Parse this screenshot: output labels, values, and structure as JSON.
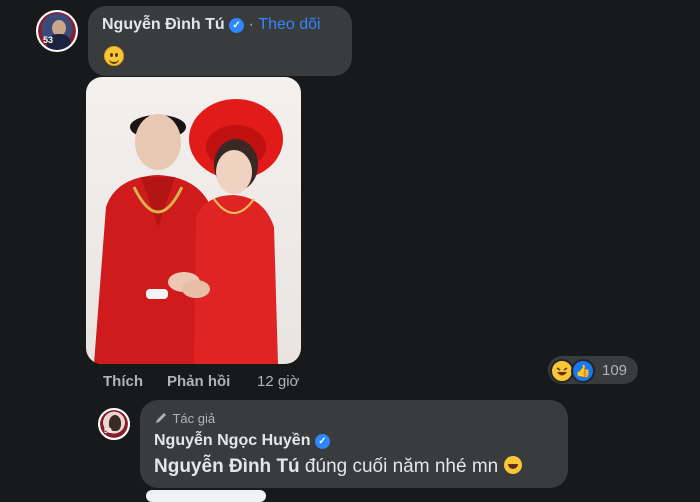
{
  "comment1": {
    "author": "Nguyễn Đình Tú",
    "follow_label": "Theo dõi",
    "separator": "·",
    "avatar_number": "53",
    "actions": {
      "like": "Thích",
      "reply": "Phản hồi",
      "time": "12 giờ"
    },
    "reactions": {
      "types": [
        "haha",
        "like"
      ],
      "count": "109"
    }
  },
  "reply": {
    "author_tag": "Tác giả",
    "author": "Nguyễn Ngọc Huyền",
    "avatar_number": "53",
    "mention": "Nguyễn Đình Tú",
    "text": " đúng cuối năm nhé mn"
  },
  "colors": {
    "background": "#18191a",
    "bubble": "#3a3b3c",
    "link": "#2d88ff",
    "secondary_text": "#b0b3b8"
  }
}
